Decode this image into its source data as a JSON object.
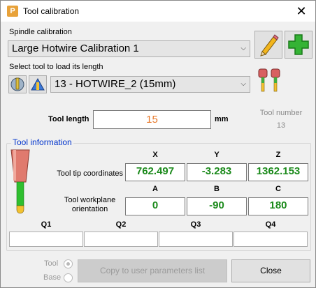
{
  "window": {
    "title": "Tool calibration",
    "app_icon": "P"
  },
  "spindle": {
    "label": "Spindle calibration",
    "selected": "Large Hotwire Calibration 1"
  },
  "tool_select": {
    "label": "Select tool to load its length",
    "selected": "13 - HOTWIRE_2 (15mm)"
  },
  "tool_length": {
    "label": "Tool length",
    "value": "15",
    "unit": "mm"
  },
  "tool_number": {
    "label": "Tool number",
    "value": "13"
  },
  "tool_info": {
    "title": "Tool information",
    "xyz_headers": [
      "X",
      "Y",
      "Z"
    ],
    "tip_label": "Tool tip coordinates",
    "tip_values": [
      "762.497",
      "-3.283",
      "1362.153"
    ],
    "abc_headers": [
      "A",
      "B",
      "C"
    ],
    "orient_label": "Tool workplane orientation",
    "orient_values": [
      "0",
      "-90",
      "180"
    ],
    "q_headers": [
      "Q1",
      "Q2",
      "Q3",
      "Q4"
    ]
  },
  "footer": {
    "radio_tool": "Tool",
    "radio_base": "Base",
    "copy_button": "Copy to user parameters list",
    "close_button": "Close"
  },
  "colors": {
    "value_green": "#1b8a1b",
    "length_orange": "#e8792a",
    "group_blue": "#0033cc"
  }
}
